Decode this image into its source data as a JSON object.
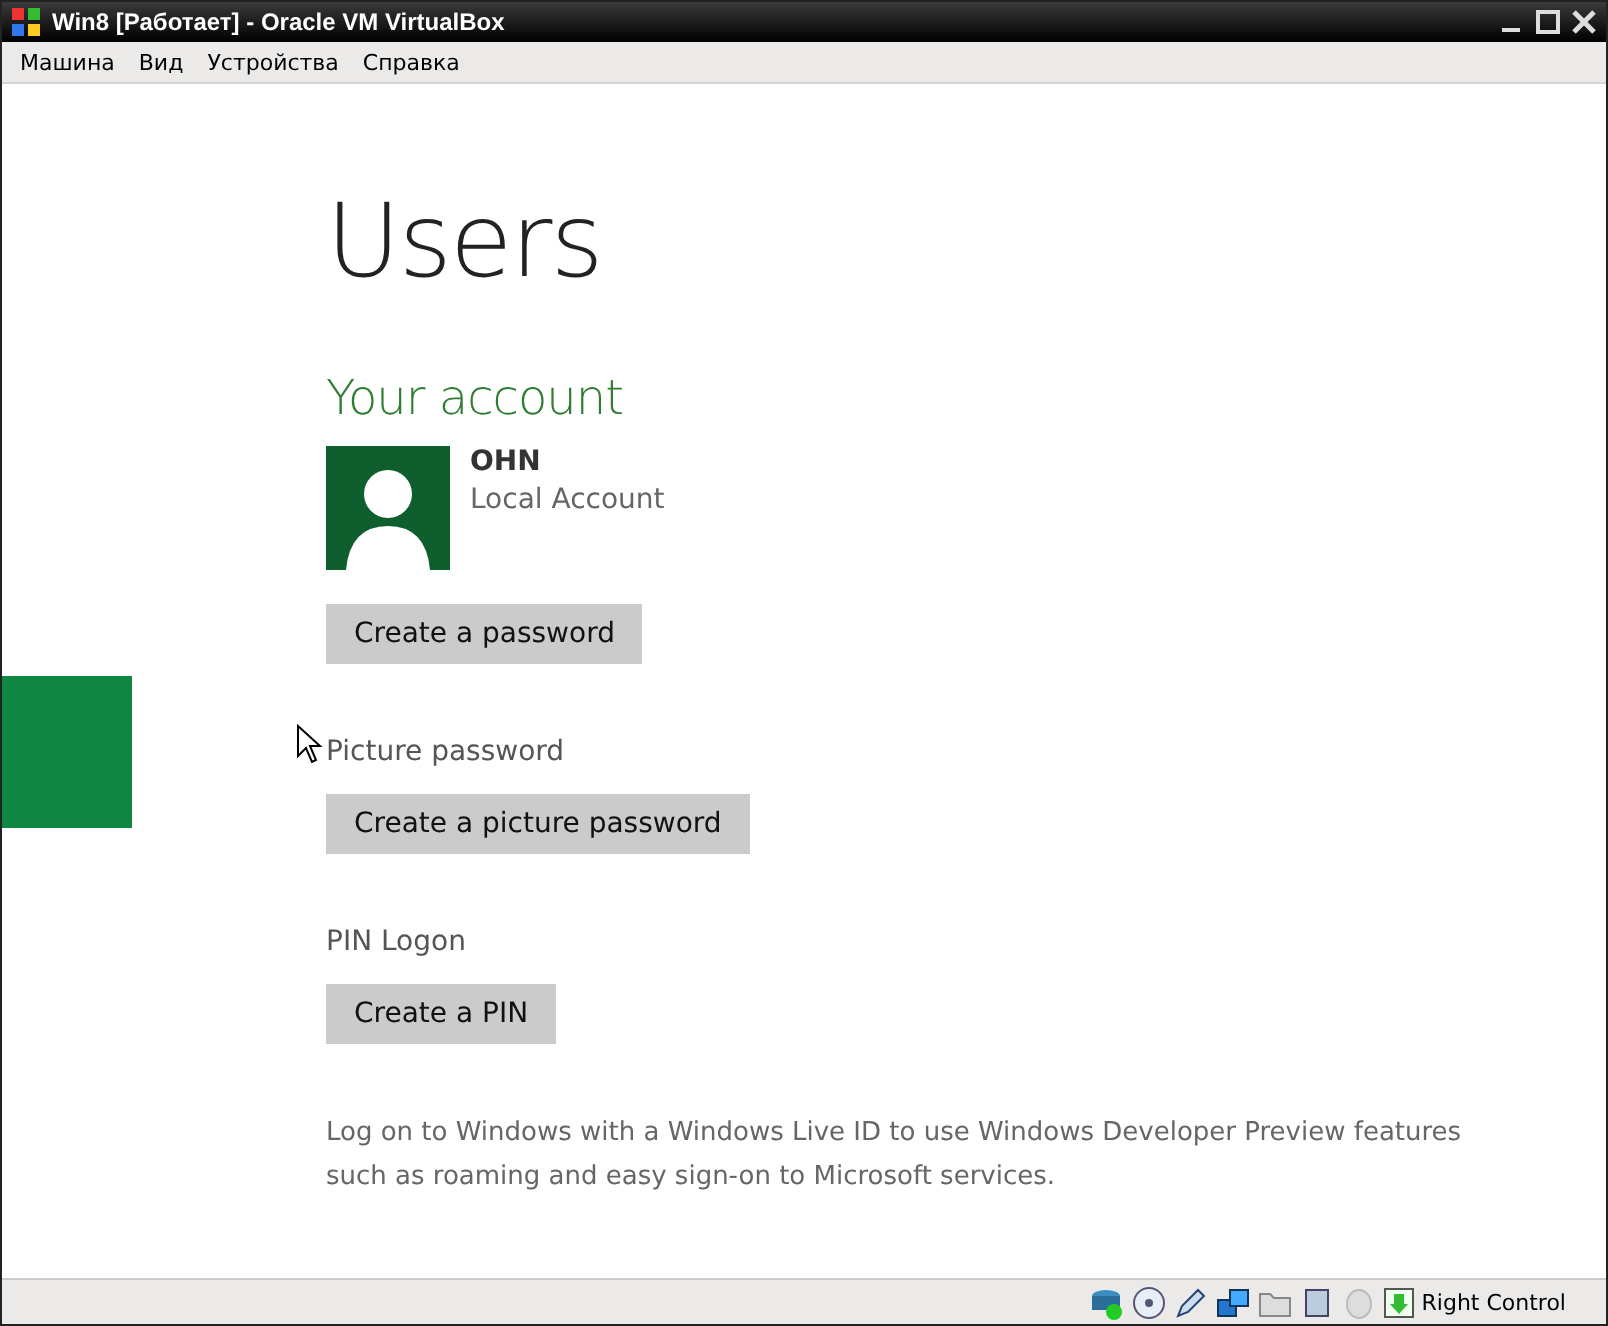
{
  "window": {
    "title": "Win8 [Работает] - Oracle VM VirtualBox"
  },
  "menu": [
    "Машина",
    "Вид",
    "Устройства",
    "Справка"
  ],
  "page": {
    "title": "Users",
    "section": "Your account",
    "account": {
      "name": "OHN",
      "type": "Local Account"
    },
    "groups": [
      {
        "button": "Create a password"
      },
      {
        "label": "Picture password",
        "button": "Create a picture password"
      },
      {
        "label": "PIN Logon",
        "button": "Create a PIN"
      }
    ],
    "note": "Log on to Windows with a Windows Live ID to use Windows Developer Preview features such as roaming and easy sign-on to Microsoft services."
  },
  "status_bar": {
    "host_key": "Right Control"
  }
}
